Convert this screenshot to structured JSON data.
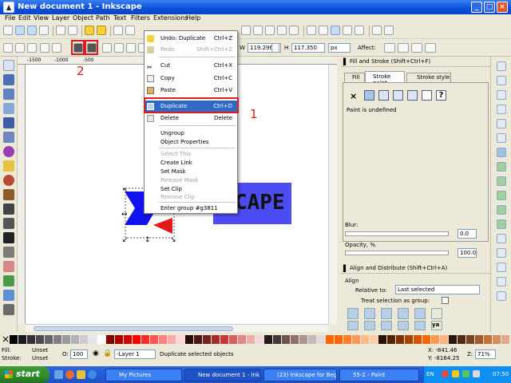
{
  "window": {
    "title": "New document 1 - Inkscape"
  },
  "menubar": [
    "File",
    "Edit",
    "View",
    "Layer",
    "Object",
    "Path",
    "Text",
    "Filters",
    "Extensions",
    "Help"
  ],
  "toolbar": {
    "w_label": "W",
    "w_value": "119.296",
    "h_label": "H",
    "h_value": "117.350",
    "unit": "px",
    "affect": "Affect:"
  },
  "ruler": {
    "ticks": [
      "-1500",
      "-1000",
      "-500"
    ]
  },
  "context_menu": {
    "items": [
      {
        "label": "Undo: Duplicate",
        "shortcut": "Ctrl+Z",
        "enabled": true
      },
      {
        "label": "Redo",
        "shortcut": "Shift+Ctrl+Z",
        "enabled": false
      },
      {
        "label": "Cut",
        "shortcut": "Ctrl+X",
        "enabled": true
      },
      {
        "label": "Copy",
        "shortcut": "Ctrl+C",
        "enabled": true
      },
      {
        "label": "Paste",
        "shortcut": "Ctrl+V",
        "enabled": true
      },
      {
        "label": "Duplicate",
        "shortcut": "Ctrl+D",
        "enabled": true,
        "highlighted": true
      },
      {
        "label": "Delete",
        "shortcut": "Delete",
        "enabled": true
      },
      {
        "label": "Ungroup",
        "shortcut": "",
        "enabled": true
      },
      {
        "label": "Object Properties",
        "shortcut": "",
        "enabled": true
      },
      {
        "label": "Select This",
        "shortcut": "",
        "enabled": false
      },
      {
        "label": "Create Link",
        "shortcut": "",
        "enabled": true
      },
      {
        "label": "Set Mask",
        "shortcut": "",
        "enabled": true
      },
      {
        "label": "Release Mask",
        "shortcut": "",
        "enabled": false
      },
      {
        "label": "Set Clip",
        "shortcut": "",
        "enabled": true
      },
      {
        "label": "Release Clip",
        "shortcut": "",
        "enabled": false
      },
      {
        "label": "Enter group #g3811",
        "shortcut": "",
        "enabled": true
      }
    ]
  },
  "annotations": {
    "one": "1",
    "two": "2"
  },
  "canvas": {
    "logo_text": "CAPE"
  },
  "fill_stroke": {
    "title": "Fill and Stroke (Shift+Ctrl+F)",
    "tabs": [
      "Fill",
      "Stroke paint",
      "Stroke style"
    ],
    "undefined_text": "Paint is undefined",
    "blur_label": "Blur:",
    "blur_value": "0.0",
    "opacity_label": "Opacity, %",
    "opacity_value": "100.0"
  },
  "align": {
    "title": "Align and Distribute (Shift+Ctrl+A)",
    "align_label": "Align",
    "relative_label": "Relative to:",
    "relative_value": "Last selected",
    "treat_group": "Treat selection as group:"
  },
  "status": {
    "fill_label": "Fill:",
    "fill_value": "Unset",
    "stroke_label": "Stroke:",
    "stroke_value": "Unset",
    "o_label": "O:",
    "o_value": "100",
    "layer": "-Layer 1",
    "message": "Duplicate selected objects",
    "x_coord": "X: -841.46",
    "y_coord": "Y: -8164.25",
    "z_label": "Z:",
    "zoom": "71%"
  },
  "taskbar": {
    "start": "start",
    "tasks": [
      "My Pictures",
      "New document 1 - Ink...",
      "(23) Inkscape for Beg...",
      "55-2 - Paint"
    ],
    "lang": "EN",
    "clock": "07:50"
  },
  "colors": {
    "selection_red": "#e1191a",
    "menu_highlight": "#316ac5",
    "shape_blue": "#1111ee",
    "shape_indigo": "#4c4cf3"
  }
}
